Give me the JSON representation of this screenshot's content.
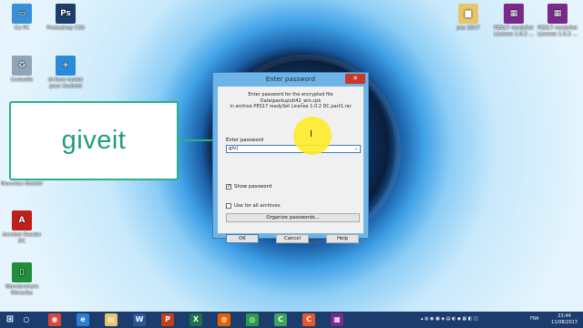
{
  "desktop": {
    "icons_left": [
      {
        "label": "Ce PC",
        "icon": "computer-icon",
        "color": "#3b8fd6"
      },
      {
        "label": "Photoshop CS6",
        "icon": "photoshop-icon",
        "color": "#1c3f6e",
        "glyph": "Ps"
      },
      {
        "label": "Corbeille",
        "icon": "recycle-bin-icon",
        "color": "#8fa6b8"
      },
      {
        "label": "dr.fone toolkit pour Android",
        "icon": "drfone-icon",
        "color": "#2b8ad8",
        "glyph": "+"
      },
      {
        "label": "Nouveau dossier",
        "icon": "folder-icon",
        "color": "#e9c46a"
      },
      {
        "label": "Acrobat Reader DC",
        "icon": "acrobat-icon",
        "color": "#c0201b",
        "glyph": "A"
      },
      {
        "label": "Wondershare MirrorGo",
        "icon": "mirrorgo-icon",
        "color": "#1f8f3a"
      }
    ],
    "icons_right": [
      {
        "label": "pes 2017",
        "icon": "folder-icon",
        "color": "#e9c46a"
      },
      {
        "label": "PES17 readySet License 1.0.2 ...",
        "icon": "winrar-archive-icon",
        "color": "#7a2a8c"
      },
      {
        "label": "PES17 readySet License 1.0.2 ...",
        "icon": "winrar-archive-icon",
        "color": "#7a2a8c"
      }
    ]
  },
  "callout": {
    "text": "giveit"
  },
  "dialog": {
    "title": "Enter password",
    "close_glyph": "✕",
    "info_lines": [
      "Enter password for the encrypted file",
      "Data\\packup\\dt42_win.cpk",
      "in archive PES17 readySet License 1.0.2 DC.part1.rar"
    ],
    "password_label": "Enter password",
    "password_value": "giv",
    "show_password_label": "Show password",
    "show_password_checked": true,
    "use_for_all_label": "Use for all archives",
    "use_for_all_checked": false,
    "organize_button": "Organize passwords...",
    "ok_button": "OK",
    "cancel_button": "Cancel",
    "help_button": "Help"
  },
  "taskbar": {
    "start_glyph": "⊞",
    "apps": [
      {
        "name": "search-icon",
        "color": "#1c3c6e",
        "glyph": "○"
      },
      {
        "name": "chrome-pinned-icon",
        "color": "#d9473b",
        "glyph": "◉"
      },
      {
        "name": "edge-icon",
        "color": "#2b7fd6",
        "glyph": "e"
      },
      {
        "name": "file-explorer-icon",
        "color": "#e9c46a",
        "glyph": "▤"
      },
      {
        "name": "word-icon",
        "color": "#2b5797",
        "glyph": "W"
      },
      {
        "name": "powerpoint-icon",
        "color": "#c43e1c",
        "glyph": "P"
      },
      {
        "name": "excel-icon",
        "color": "#1e7145",
        "glyph": "X"
      },
      {
        "name": "firefox-icon",
        "color": "#e66000",
        "glyph": "◍"
      },
      {
        "name": "chrome-icon",
        "color": "#2a9d4a",
        "glyph": "◎"
      },
      {
        "name": "camtasia-icon",
        "color": "#3ba55c",
        "glyph": "C"
      },
      {
        "name": "app-orange-icon",
        "color": "#e4572e",
        "glyph": "C"
      },
      {
        "name": "winrar-icon",
        "color": "#7a2a8c",
        "glyph": "▦"
      }
    ],
    "language": "FRA",
    "time": "23:44",
    "date": "11/08/2017"
  }
}
